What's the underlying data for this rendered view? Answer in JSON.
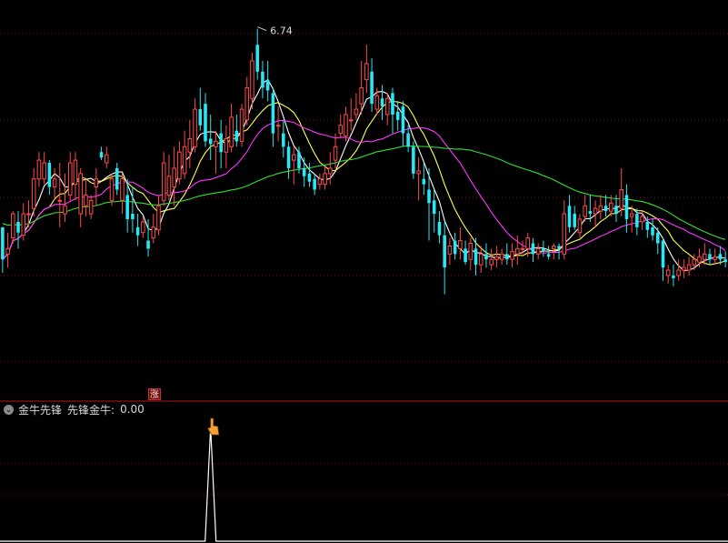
{
  "chart_data": {
    "type": "candlestick",
    "high_label": "6.74",
    "ylim": [
      5.45,
      6.82
    ],
    "colors": {
      "up": "#ff4a4a",
      "down": "#29e8f5",
      "ma5": "#ffffff",
      "ma10": "#ffff55",
      "ma20": "#ff33ff",
      "ma60": "#33dd33",
      "grid": "#7a0d0d",
      "indicator": "#ffffff"
    },
    "candles": [
      [
        6.0,
        6.0,
        5.88,
        5.83
      ],
      [
        5.9,
        5.98,
        5.92,
        5.85
      ],
      [
        5.96,
        6.06,
        6.05,
        5.94
      ],
      [
        6.02,
        6.06,
        5.98,
        5.92
      ],
      [
        5.97,
        6.09,
        6.05,
        5.95
      ],
      [
        6.05,
        6.1,
        6.05,
        6.0
      ],
      [
        6.07,
        6.22,
        6.18,
        6.04
      ],
      [
        6.18,
        6.28,
        6.25,
        6.15
      ],
      [
        6.18,
        6.28,
        6.24,
        6.16
      ],
      [
        6.24,
        6.25,
        6.15,
        6.12
      ],
      [
        6.15,
        6.22,
        6.18,
        6.1
      ],
      [
        6.1,
        6.24,
        6.1,
        6.0
      ],
      [
        6.05,
        6.2,
        6.08,
        6.02
      ],
      [
        6.12,
        6.28,
        6.24,
        6.1
      ],
      [
        6.16,
        6.28,
        6.25,
        6.1
      ],
      [
        6.05,
        6.22,
        6.2,
        6.0
      ],
      [
        6.08,
        6.18,
        6.12,
        6.04
      ],
      [
        6.05,
        6.12,
        6.1,
        6.03
      ],
      [
        6.15,
        6.22,
        6.18,
        6.08
      ],
      [
        6.28,
        6.3,
        6.26,
        6.25
      ],
      [
        6.24,
        6.3,
        6.27,
        6.22
      ],
      [
        6.1,
        6.2,
        6.18,
        6.08
      ],
      [
        6.22,
        6.24,
        6.14,
        6.12
      ],
      [
        6.1,
        6.2,
        6.18,
        6.05
      ],
      [
        6.12,
        6.18,
        6.03,
        5.98
      ],
      [
        6.05,
        6.15,
        6.03,
        5.98
      ],
      [
        6.0,
        6.05,
        5.97,
        5.93
      ],
      [
        5.98,
        6.04,
        6.02,
        5.96
      ],
      [
        5.95,
        6.03,
        5.92,
        5.89
      ],
      [
        5.96,
        6.05,
        6.0,
        5.94
      ],
      [
        5.99,
        6.12,
        6.08,
        5.97
      ],
      [
        6.1,
        6.28,
        6.24,
        6.08
      ],
      [
        6.12,
        6.27,
        6.19,
        6.1
      ],
      [
        6.15,
        6.3,
        6.22,
        6.08
      ],
      [
        6.18,
        6.32,
        6.28,
        6.16
      ],
      [
        6.2,
        6.36,
        6.3,
        6.18
      ],
      [
        6.28,
        6.4,
        6.33,
        6.22
      ],
      [
        6.3,
        6.48,
        6.44,
        6.28
      ],
      [
        6.44,
        6.52,
        6.38,
        6.36
      ],
      [
        6.46,
        6.5,
        6.32,
        6.3
      ],
      [
        6.33,
        6.42,
        6.31,
        6.25
      ],
      [
        6.3,
        6.36,
        6.32,
        6.2
      ],
      [
        6.35,
        6.4,
        6.28,
        6.22
      ],
      [
        6.28,
        6.38,
        6.33,
        6.22
      ],
      [
        6.3,
        6.46,
        6.41,
        6.28
      ],
      [
        6.36,
        6.42,
        6.32,
        6.3
      ],
      [
        6.32,
        6.46,
        6.44,
        6.3
      ],
      [
        6.4,
        6.56,
        6.52,
        6.38
      ],
      [
        6.48,
        6.65,
        6.62,
        6.44
      ],
      [
        6.68,
        6.74,
        6.58,
        6.55
      ],
      [
        6.58,
        6.62,
        6.52,
        6.48
      ],
      [
        6.55,
        6.62,
        6.51,
        6.47
      ],
      [
        6.5,
        6.52,
        6.35,
        6.3
      ],
      [
        6.38,
        6.45,
        6.38,
        6.32
      ],
      [
        6.35,
        6.4,
        6.3,
        6.26
      ],
      [
        6.3,
        6.32,
        6.22,
        6.18
      ],
      [
        6.25,
        6.3,
        6.27,
        6.16
      ],
      [
        6.28,
        6.3,
        6.22,
        6.2
      ],
      [
        6.22,
        6.26,
        6.19,
        6.15
      ],
      [
        6.2,
        6.24,
        6.17,
        6.15
      ],
      [
        6.18,
        6.2,
        6.14,
        6.12
      ],
      [
        6.16,
        6.2,
        6.18,
        6.14
      ],
      [
        6.16,
        6.23,
        6.2,
        6.14
      ],
      [
        6.2,
        6.28,
        6.22,
        6.16
      ],
      [
        6.25,
        6.35,
        6.3,
        6.22
      ],
      [
        6.35,
        6.42,
        6.38,
        6.33
      ],
      [
        6.34,
        6.45,
        6.42,
        6.32
      ],
      [
        6.4,
        6.48,
        6.4,
        6.36
      ],
      [
        6.42,
        6.5,
        6.44,
        6.4
      ],
      [
        6.46,
        6.62,
        6.52,
        6.42
      ],
      [
        6.55,
        6.68,
        6.61,
        6.5
      ],
      [
        6.58,
        6.63,
        6.46,
        6.43
      ],
      [
        6.44,
        6.52,
        6.49,
        6.42
      ],
      [
        6.48,
        6.53,
        6.45,
        6.4
      ],
      [
        6.42,
        6.5,
        6.48,
        6.38
      ],
      [
        6.5,
        6.52,
        6.42,
        6.35
      ],
      [
        6.43,
        6.47,
        6.4,
        6.36
      ],
      [
        6.45,
        6.47,
        6.35,
        6.3
      ],
      [
        6.35,
        6.38,
        6.3,
        6.28
      ],
      [
        6.3,
        6.32,
        6.2,
        6.18
      ],
      [
        6.2,
        6.26,
        6.21,
        6.1
      ],
      [
        6.18,
        6.24,
        6.16,
        6.12
      ],
      [
        6.14,
        6.22,
        6.09,
        5.95
      ],
      [
        6.1,
        6.14,
        6.05,
        5.98
      ],
      [
        6.02,
        6.06,
        5.97,
        5.94
      ],
      [
        5.97,
        6.02,
        5.85,
        5.75
      ],
      [
        5.9,
        5.96,
        5.93,
        5.86
      ],
      [
        5.95,
        5.98,
        5.9,
        5.88
      ],
      [
        5.92,
        6.0,
        5.95,
        5.88
      ],
      [
        5.92,
        5.95,
        5.87,
        5.86
      ],
      [
        5.88,
        5.96,
        5.94,
        5.84
      ],
      [
        5.92,
        5.96,
        5.86,
        5.82
      ],
      [
        5.86,
        5.93,
        5.9,
        5.83
      ],
      [
        5.9,
        5.94,
        5.88,
        5.85
      ],
      [
        5.86,
        5.92,
        5.88,
        5.84
      ],
      [
        5.88,
        5.93,
        5.89,
        5.85
      ],
      [
        5.88,
        5.92,
        5.9,
        5.86
      ],
      [
        5.9,
        5.94,
        5.88,
        5.86
      ],
      [
        5.88,
        5.94,
        5.91,
        5.85
      ],
      [
        5.9,
        5.97,
        5.92,
        5.86
      ],
      [
        5.92,
        5.95,
        5.92,
        5.9
      ],
      [
        5.92,
        5.98,
        5.96,
        5.89
      ],
      [
        5.94,
        5.96,
        5.9,
        5.87
      ],
      [
        5.9,
        5.94,
        5.92,
        5.88
      ],
      [
        5.92,
        5.95,
        5.91,
        5.89
      ],
      [
        5.9,
        5.93,
        5.89,
        5.88
      ],
      [
        5.92,
        5.94,
        5.93,
        5.88
      ],
      [
        5.93,
        5.94,
        5.92,
        5.88
      ],
      [
        5.9,
        6.1,
        6.05,
        5.88
      ],
      [
        6.08,
        6.12,
        6.0,
        5.98
      ],
      [
        6.05,
        6.08,
        6.0,
        5.99
      ],
      [
        5.98,
        6.05,
        6.03,
        5.96
      ],
      [
        6.04,
        6.12,
        6.08,
        6.02
      ],
      [
        6.06,
        6.12,
        6.05,
        6.02
      ],
      [
        6.05,
        6.1,
        6.07,
        6.0
      ],
      [
        6.06,
        6.12,
        6.08,
        6.03
      ],
      [
        6.08,
        6.12,
        6.06,
        6.04
      ],
      [
        6.06,
        6.12,
        6.09,
        6.04
      ],
      [
        6.08,
        6.12,
        6.05,
        6.02
      ],
      [
        6.07,
        6.22,
        6.14,
        6.04
      ],
      [
        6.12,
        6.16,
        6.03,
        5.98
      ],
      [
        6.04,
        6.08,
        6.05,
        5.98
      ],
      [
        6.05,
        6.07,
        6.0,
        5.97
      ],
      [
        6.02,
        6.06,
        6.04,
        5.99
      ],
      [
        6.02,
        6.04,
        5.99,
        5.96
      ],
      [
        6.0,
        6.03,
        5.97,
        5.95
      ],
      [
        5.98,
        6.0,
        5.94,
        5.9
      ],
      [
        5.95,
        5.96,
        5.85,
        5.8
      ],
      [
        5.82,
        5.86,
        5.84,
        5.79
      ],
      [
        5.82,
        5.86,
        5.81,
        5.78
      ],
      [
        5.82,
        5.88,
        5.84,
        5.8
      ],
      [
        5.84,
        5.88,
        5.85,
        5.81
      ],
      [
        5.84,
        5.89,
        5.86,
        5.82
      ],
      [
        5.86,
        5.9,
        5.88,
        5.84
      ],
      [
        5.87,
        5.92,
        5.89,
        5.85
      ],
      [
        5.88,
        5.94,
        5.9,
        5.86
      ],
      [
        5.9,
        5.92,
        5.88,
        5.86
      ],
      [
        5.88,
        5.92,
        5.89,
        5.86
      ],
      [
        5.9,
        5.93,
        5.88,
        5.86
      ],
      [
        5.88,
        5.91,
        5.87,
        5.85
      ]
    ],
    "ma": [
      {
        "name": "MA5",
        "period": 5,
        "color": "#ffffff"
      },
      {
        "name": "MA10",
        "period": 10,
        "color": "#ffff55"
      },
      {
        "name": "MA20",
        "period": 20,
        "color": "#ff33ff"
      },
      {
        "name": "MA60",
        "period": 60,
        "color": "#33dd33",
        "seed": [
          6.05,
          6.04,
          6.03,
          6.02,
          6.01,
          6.0,
          6.0,
          6.01,
          6.02,
          6.03,
          6.04,
          6.05
        ]
      }
    ],
    "signal": {
      "index": 40,
      "value": 1
    },
    "signal_marker": "涨"
  },
  "indicator": {
    "name": "金牛先锋",
    "value_label": "先锋金牛:",
    "value": "0.00"
  },
  "icons": {
    "collapse": "chevron-down-icon",
    "pointer": "hand-pointer-icon"
  }
}
